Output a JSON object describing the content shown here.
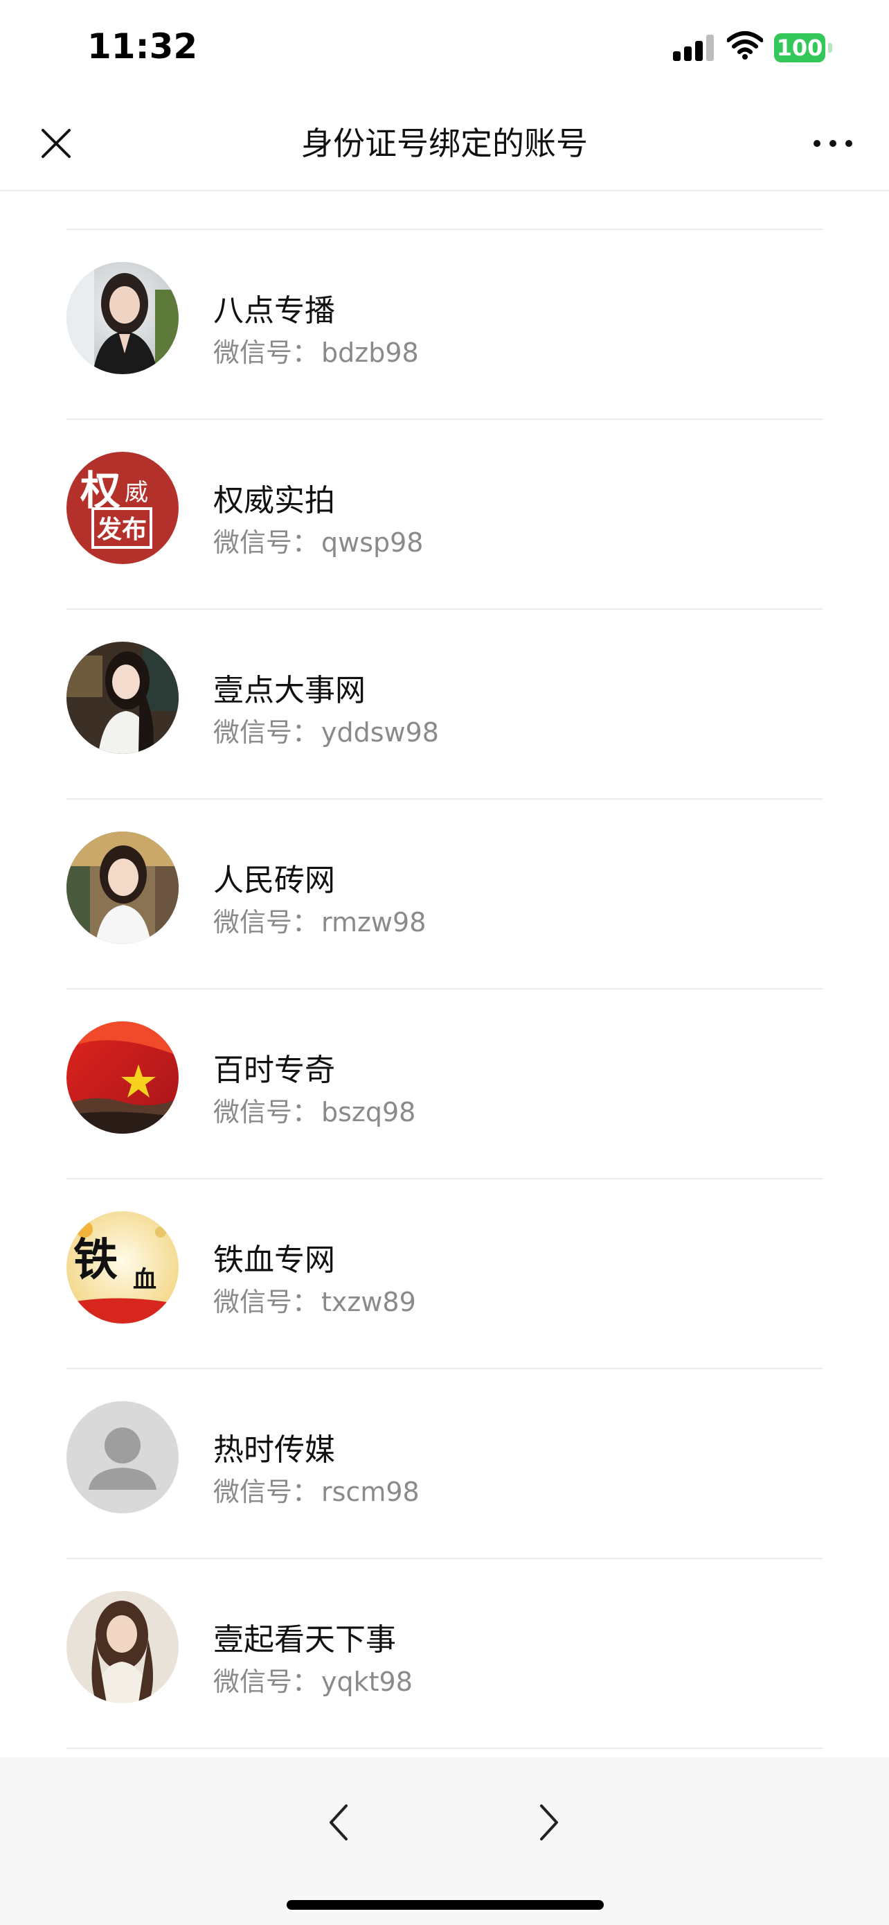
{
  "status": {
    "time": "11:32",
    "battery": "100"
  },
  "nav": {
    "title": "身份证号绑定的账号"
  },
  "id_prefix": "微信号：",
  "accounts": [
    {
      "name": "八点专播",
      "wechat_id": "bdzb98",
      "avatar": "woman-portrait-avatar"
    },
    {
      "name": "权威实拍",
      "wechat_id": "qwsp98",
      "avatar": "quanwei-fabu-logo-avatar"
    },
    {
      "name": "壹点大事网",
      "wechat_id": "yddsw98",
      "avatar": "woman-portrait-avatar"
    },
    {
      "name": "人民砖网",
      "wechat_id": "rmzw98",
      "avatar": "woman-portrait-avatar"
    },
    {
      "name": "百时专奇",
      "wechat_id": "bszq98",
      "avatar": "flag-greatwall-avatar"
    },
    {
      "name": "铁血专网",
      "wechat_id": "txzw89",
      "avatar": "tiexue-calligraphy-avatar"
    },
    {
      "name": "热时传媒",
      "wechat_id": "rscm98",
      "avatar": "default-person-avatar"
    },
    {
      "name": "壹起看天下事",
      "wechat_id": "yqkt98",
      "avatar": "woman-portrait-avatar"
    }
  ],
  "logo_text": {
    "quanwei": [
      "权",
      "威",
      "发布"
    ],
    "tiexue": [
      "铁",
      "血"
    ]
  },
  "colors": {
    "divider": "#ececec",
    "subtext": "#8a8a8a",
    "battery": "#34c759",
    "bottom_bar": "#f7f7f7"
  }
}
